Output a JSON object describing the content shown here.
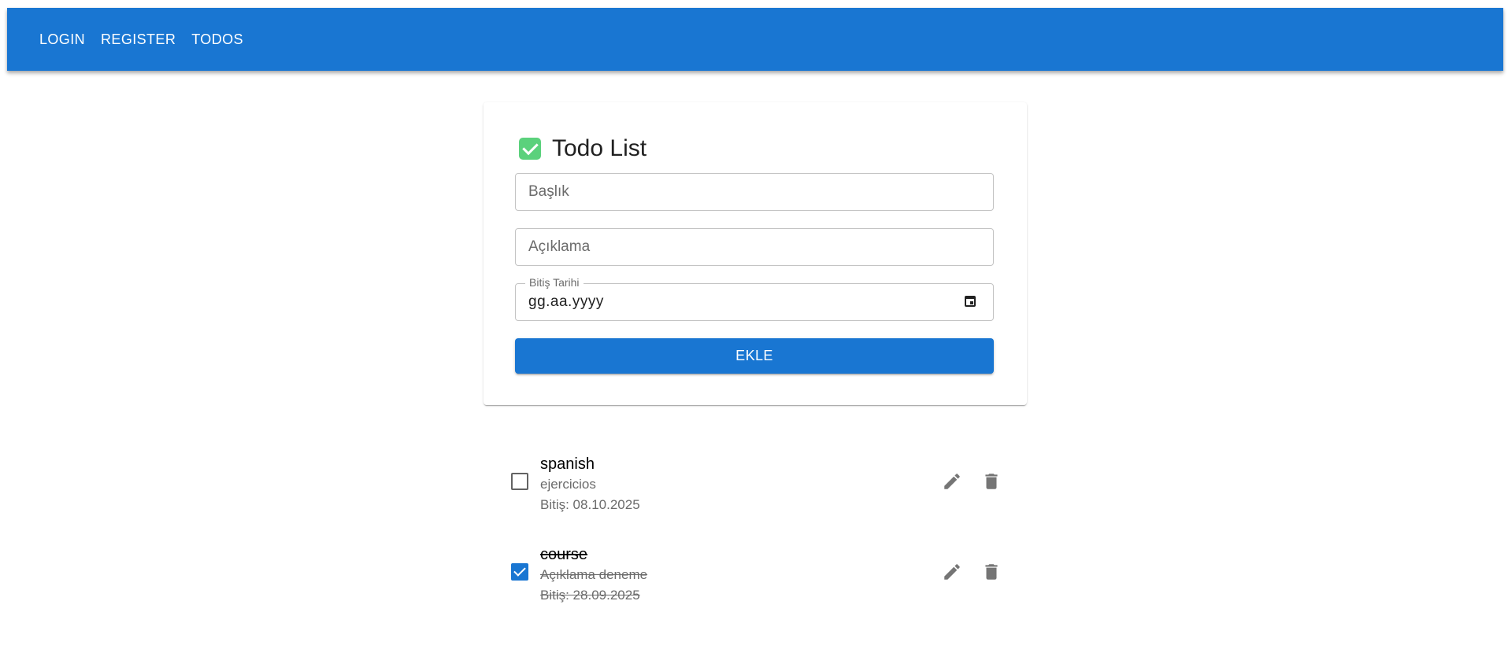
{
  "nav": {
    "items": [
      {
        "label": "LOGIN"
      },
      {
        "label": "REGISTER"
      },
      {
        "label": "TODOS"
      }
    ]
  },
  "card": {
    "title_icon": "check-mark-emoji",
    "title": "Todo List",
    "title_field": {
      "placeholder": "Başlık",
      "value": ""
    },
    "description_field": {
      "placeholder": "Açıklama",
      "value": ""
    },
    "due_date_field": {
      "label": "Bitiş Tarihi",
      "value": "gg.aa.yyyy"
    },
    "add_button": "EKLE"
  },
  "todos": [
    {
      "title": "spanish",
      "description": "ejercicios",
      "due": "Bitiş: 08.10.2025",
      "completed": false
    },
    {
      "title": "course",
      "description": "Açıklama deneme",
      "due": "Bitiş: 28.09.2025",
      "completed": true
    }
  ],
  "colors": {
    "primary": "#1976d2",
    "icon_gray": "#757575",
    "secondary_text": "#6b6b6b"
  }
}
